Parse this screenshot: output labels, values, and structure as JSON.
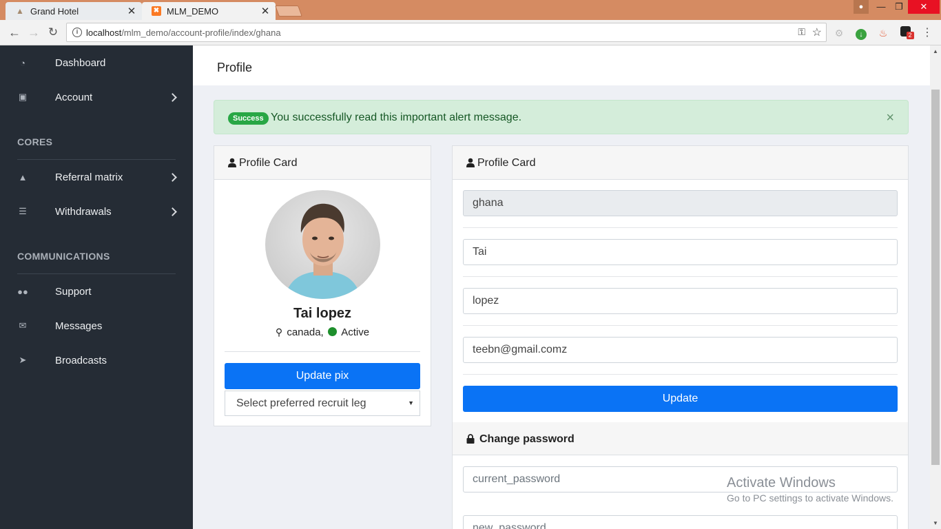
{
  "browser": {
    "tabs": [
      {
        "title": "Grand Hotel",
        "icon": "hotel-icon"
      },
      {
        "title": "MLM_DEMO",
        "icon": "xampp-icon"
      }
    ],
    "url_host": "localhost",
    "url_path": "/mlm_demo/account-profile/index/ghana",
    "extension_badge": "2"
  },
  "sidebar": {
    "items": [
      {
        "label": "Dashboard",
        "icon": "dashboard-icon"
      },
      {
        "label": "Account",
        "icon": "briefcase-icon"
      }
    ],
    "cores_heading": "CORES",
    "cores_items": [
      {
        "label": "Referral matrix",
        "icon": "sitemap-icon"
      },
      {
        "label": "Withdrawals",
        "icon": "list-icon"
      }
    ],
    "comm_heading": "COMMUNICATIONS",
    "comm_items": [
      {
        "label": "Support",
        "icon": "users-icon"
      },
      {
        "label": "Messages",
        "icon": "envelope-icon"
      },
      {
        "label": "Broadcasts",
        "icon": "bullhorn-icon"
      }
    ]
  },
  "page": {
    "title": "Profile"
  },
  "alert": {
    "badge": "Success",
    "message": "You successfully read this important alert message.",
    "close": "×"
  },
  "profile_card": {
    "title": "Profile Card",
    "name": "Tai lopez",
    "location": "canada,",
    "status": "Active",
    "status_color": "#1e8f2c",
    "update_pix_label": "Update pix",
    "recruit_leg_select": "Select preferred recruit leg"
  },
  "edit_card": {
    "title": "Profile Card",
    "username": "ghana",
    "first_name": "Tai",
    "last_name": "lopez",
    "email": "teebn@gmail.comz",
    "update_label": "Update",
    "password_title": "Change password",
    "current_password_placeholder": "current_password",
    "new_password_placeholder": "new_password"
  },
  "watermark": {
    "line1": "Activate Windows",
    "line2": "Go to PC settings to activate Windows."
  },
  "colors": {
    "accent": "#0a73f5",
    "sidebar_bg": "#252c35",
    "success_bg": "#d4edda"
  }
}
